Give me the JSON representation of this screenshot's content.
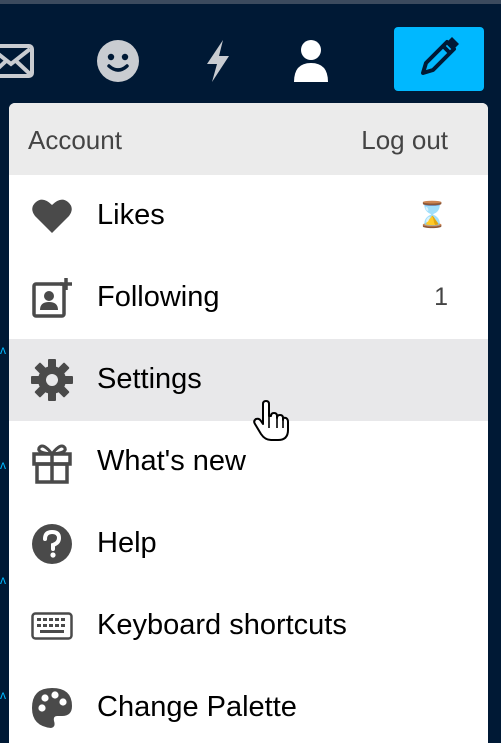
{
  "topbar": {
    "icons": [
      "mail-icon",
      "emoji-icon",
      "lightning-icon",
      "account-icon"
    ],
    "compose_icon": "pencil-icon",
    "accent_color": "#00b8ff",
    "background_color": "#001935"
  },
  "menu": {
    "header": {
      "title": "Account",
      "logout_label": "Log out"
    },
    "items": [
      {
        "label": "Likes",
        "icon": "heart-icon",
        "meta": "⌛"
      },
      {
        "label": "Following",
        "icon": "follow-person-icon",
        "meta": "1"
      },
      {
        "label": "Settings",
        "icon": "gear-icon",
        "meta": "",
        "hovered": true
      },
      {
        "label": "What's new",
        "icon": "gift-icon",
        "meta": ""
      },
      {
        "label": "Help",
        "icon": "question-icon",
        "meta": ""
      },
      {
        "label": "Keyboard shortcuts",
        "icon": "keyboard-icon",
        "meta": ""
      },
      {
        "label": "Change Palette",
        "icon": "palette-icon",
        "meta": ""
      }
    ]
  }
}
